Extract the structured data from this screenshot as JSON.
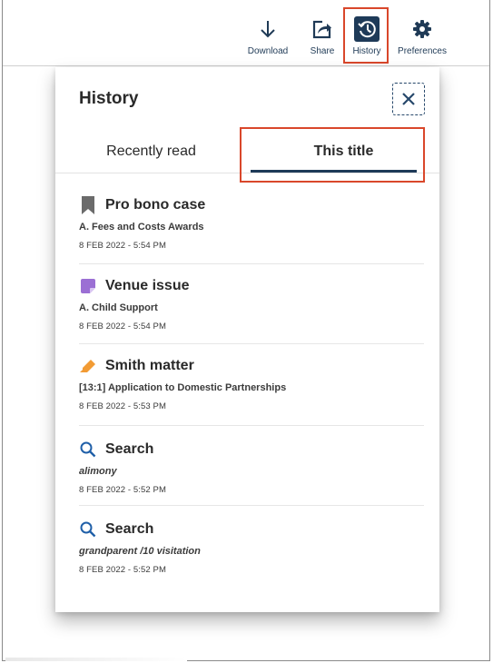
{
  "toolbar": {
    "download_label": "Download",
    "share_label": "Share",
    "history_label": "History",
    "preferences_label": "Preferences",
    "icons": {
      "download": "download-arrow-icon",
      "share": "share-icon",
      "history": "history-clock-icon",
      "preferences": "gear-icon"
    }
  },
  "panel": {
    "title": "History",
    "close_icon": "close-icon",
    "tabs": [
      {
        "label": "Recently read",
        "active": false
      },
      {
        "label": "This title",
        "active": true
      }
    ],
    "items": [
      {
        "icon": "bookmark-icon",
        "icon_color": "#6b6b6b",
        "title": "Pro bono case",
        "subtitle": "A. Fees and Costs Awards",
        "subtitle_italic": false,
        "date": "8 FEB 2022 - 5:54 PM"
      },
      {
        "icon": "note-icon",
        "icon_color": "#9b6fd4",
        "title": "Venue issue",
        "subtitle": "A. Child Support",
        "subtitle_italic": false,
        "date": "8 FEB 2022 - 5:54 PM"
      },
      {
        "icon": "highlighter-icon",
        "icon_color": "#f29b34",
        "title": "Smith matter",
        "subtitle": "[13:1] Application to Domestic Partnerships",
        "subtitle_italic": false,
        "date": "8 FEB 2022 - 5:53 PM"
      },
      {
        "icon": "search-icon",
        "icon_color": "#1f5fa8",
        "title": "Search",
        "subtitle": "alimony",
        "subtitle_italic": true,
        "date": "8 FEB 2022 - 5:52 PM"
      },
      {
        "icon": "search-icon",
        "icon_color": "#1f5fa8",
        "title": "Search",
        "subtitle": "grandparent /10 visitation",
        "subtitle_italic": true,
        "date": "8 FEB 2022 - 5:52 PM"
      }
    ]
  },
  "colors": {
    "highlight_border": "#d9472b",
    "navy": "#1e3a58"
  }
}
